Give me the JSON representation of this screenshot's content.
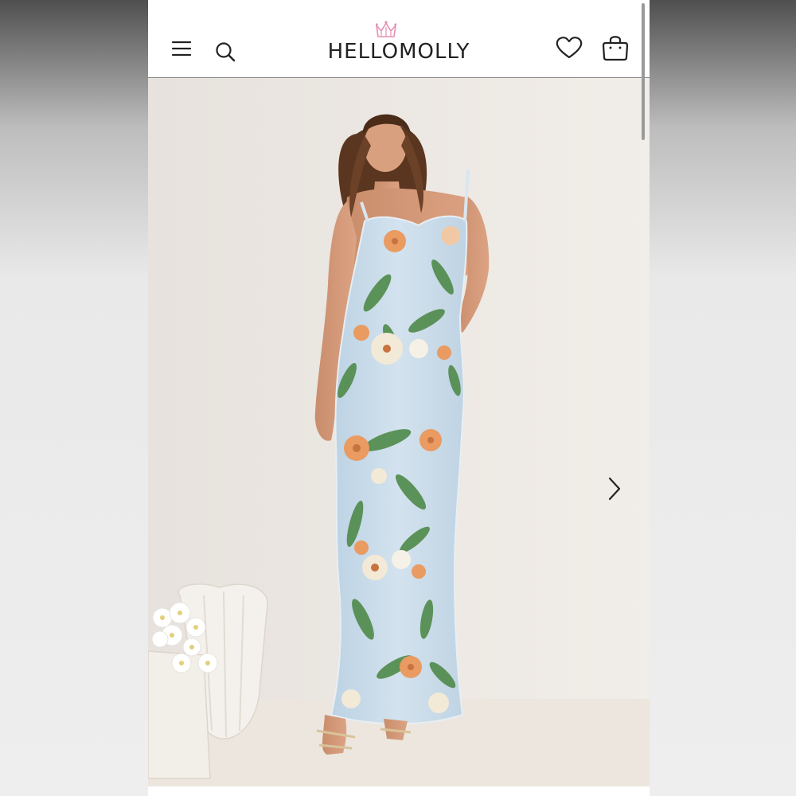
{
  "brand": {
    "logo_text": "HELLOMOLLY"
  },
  "header": {
    "menu_icon": "hamburger-menu-icon",
    "search_icon": "search-icon",
    "wishlist_icon": "heart-icon",
    "cart_icon": "shopping-bag-icon"
  },
  "gallery": {
    "next_icon": "chevron-right-icon"
  },
  "colors": {
    "header_bg": "#ffffff",
    "text": "#222222",
    "crown_pink": "#e58fb4",
    "dress_blue": "#c9dcea",
    "leaf_green": "#4f8a4a",
    "flower_orange": "#e99b62"
  }
}
